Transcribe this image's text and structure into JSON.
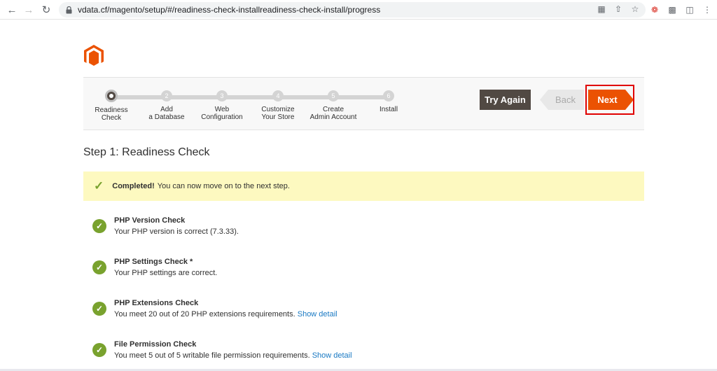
{
  "browser": {
    "url": "vdata.cf/magento/setup/#/readiness-check-installreadiness-check-install/progress"
  },
  "progress": {
    "steps": [
      {
        "number": "",
        "label_line1": "Readiness",
        "label_line2": "Check"
      },
      {
        "number": "2",
        "label_line1": "Add",
        "label_line2": "a Database"
      },
      {
        "number": "3",
        "label_line1": "Web",
        "label_line2": "Configuration"
      },
      {
        "number": "4",
        "label_line1": "Customize",
        "label_line2": "Your Store"
      },
      {
        "number": "5",
        "label_line1": "Create",
        "label_line2": "Admin Account"
      },
      {
        "number": "6",
        "label_line1": "Install",
        "label_line2": ""
      }
    ],
    "try_again_label": "Try Again",
    "back_label": "Back",
    "next_label": "Next"
  },
  "main": {
    "step_title": "Step 1: Readiness Check",
    "message_strong": "Completed!",
    "message_text": "You can now move on to the next step.",
    "checks": [
      {
        "title": "PHP Version Check",
        "desc": "Your PHP version is correct (7.3.33).",
        "link": ""
      },
      {
        "title": "PHP Settings Check *",
        "desc": "Your PHP settings are correct.",
        "link": ""
      },
      {
        "title": "PHP Extensions Check",
        "desc": "You meet 20 out of 20 PHP extensions requirements.",
        "link": "Show detail"
      },
      {
        "title": "File Permission Check",
        "desc": "You meet 5 out of 5 writable file permission requirements.",
        "link": "Show detail"
      }
    ]
  },
  "colors": {
    "brand_orange": "#eb5202",
    "success_green": "#79a22e",
    "dark_button": "#514943",
    "highlight_red": "#e00000"
  }
}
